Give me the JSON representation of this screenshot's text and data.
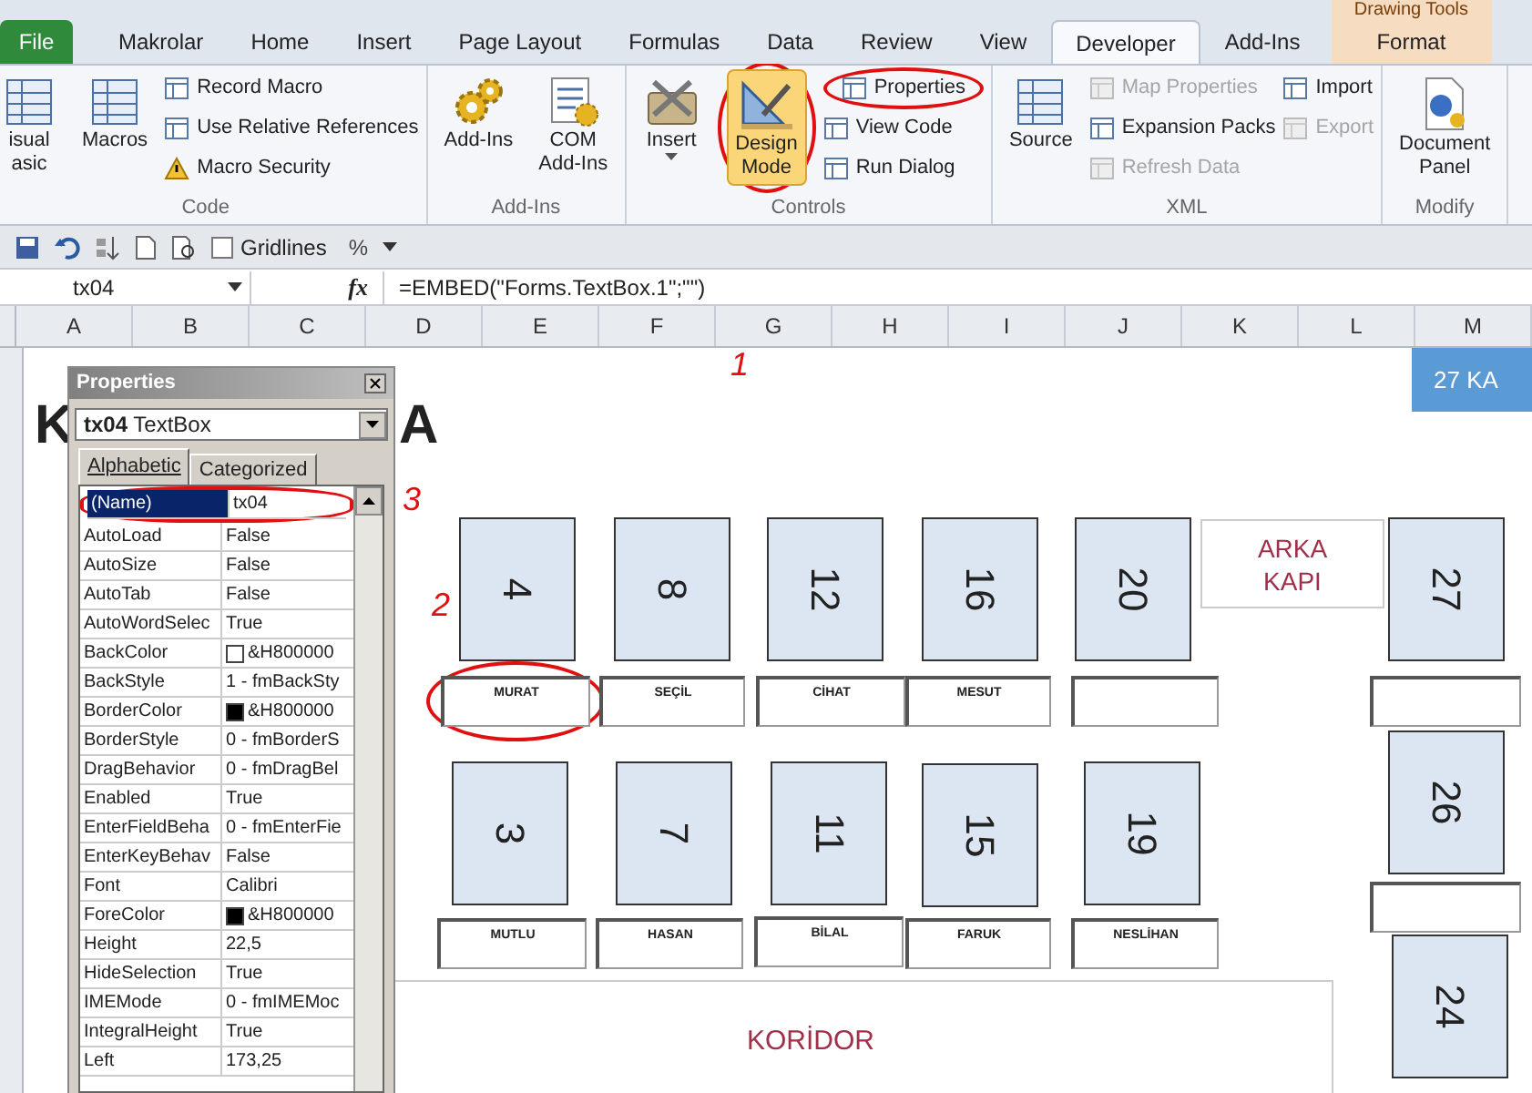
{
  "contextual_tab_group": "Drawing Tools",
  "tabs": [
    {
      "label": "File",
      "kind": "file",
      "selected": false
    },
    {
      "label": "Makrolar",
      "kind": "tab",
      "selected": false
    },
    {
      "label": "Home",
      "kind": "tab",
      "selected": false
    },
    {
      "label": "Insert",
      "kind": "tab",
      "selected": false
    },
    {
      "label": "Page Layout",
      "kind": "tab",
      "selected": false
    },
    {
      "label": "Formulas",
      "kind": "tab",
      "selected": false
    },
    {
      "label": "Data",
      "kind": "tab",
      "selected": false
    },
    {
      "label": "Review",
      "kind": "tab",
      "selected": false
    },
    {
      "label": "View",
      "kind": "tab",
      "selected": false
    },
    {
      "label": "Developer",
      "kind": "tab",
      "selected": true
    },
    {
      "label": "Add-Ins",
      "kind": "tab",
      "selected": false
    },
    {
      "label": "Format",
      "kind": "contextual",
      "selected": false
    }
  ],
  "ribbon_groups": [
    {
      "label": "Code",
      "items": [
        {
          "kind": "large",
          "lines": [
            "isual",
            "asic"
          ],
          "selected": false,
          "disabled": false
        },
        {
          "kind": "large",
          "lines": [
            "Macros"
          ],
          "selected": false,
          "disabled": false
        },
        {
          "kind": "stack",
          "entries": [
            {
              "label": "Record Macro",
              "disabled": false
            },
            {
              "label": "Use Relative References",
              "disabled": false
            },
            {
              "label": "Macro Security",
              "disabled": false
            }
          ]
        }
      ]
    },
    {
      "label": "Add-Ins",
      "items": [
        {
          "kind": "large",
          "lines": [
            "Add-Ins"
          ],
          "selected": false,
          "disabled": false
        },
        {
          "kind": "large",
          "lines": [
            "COM",
            "Add-Ins"
          ],
          "selected": false,
          "disabled": false
        }
      ]
    },
    {
      "label": "Controls",
      "items": [
        {
          "kind": "dropdown",
          "lines": [
            "Insert"
          ],
          "selected": false,
          "disabled": false
        },
        {
          "kind": "large",
          "lines": [
            "Design",
            "Mode"
          ],
          "selected": true,
          "disabled": false
        },
        {
          "kind": "stack",
          "entries": [
            {
              "label": "Properties",
              "disabled": false
            },
            {
              "label": "View Code",
              "disabled": false
            },
            {
              "label": "Run Dialog",
              "disabled": false
            }
          ]
        }
      ]
    },
    {
      "label": "XML",
      "items": [
        {
          "kind": "large",
          "lines": [
            "Source"
          ],
          "selected": false,
          "disabled": false
        },
        {
          "kind": "stack",
          "entries": [
            {
              "label": "Map Properties",
              "disabled": true
            },
            {
              "label": "Expansion Packs",
              "disabled": false
            },
            {
              "label": "Refresh Data",
              "disabled": true
            }
          ]
        },
        {
          "kind": "stack",
          "entries": [
            {
              "label": "Import",
              "disabled": false
            },
            {
              "label": "Export",
              "disabled": true
            }
          ]
        }
      ]
    },
    {
      "label": "Modify",
      "items": [
        {
          "kind": "large",
          "lines": [
            "Document",
            "Panel"
          ],
          "selected": false,
          "disabled": false
        }
      ]
    }
  ],
  "quick_access": {
    "gridlines": {
      "label": "Gridlines",
      "checked": false
    },
    "percent": "%"
  },
  "formula_bar": {
    "name_box": "tx04",
    "fx": "fx",
    "formula": "=EMBED(\"Forms.TextBox.1\";\"\")"
  },
  "columns": [
    "A",
    "B",
    "C",
    "D",
    "E",
    "F",
    "G",
    "H",
    "I",
    "J",
    "K",
    "L",
    "M"
  ],
  "sheet": {
    "title_left": "K",
    "title_right": "A",
    "corner_button": "27 KA",
    "back_door": [
      "ARKA",
      "KAPI"
    ],
    "corridor": "KORİDOR",
    "seats": [
      {
        "number": "4",
        "name": "MURAT"
      },
      {
        "number": "8",
        "name": "SEÇİL"
      },
      {
        "number": "12",
        "name": "CİHAT"
      },
      {
        "number": "16",
        "name": "MESUT"
      },
      {
        "number": "20"
      },
      {
        "number": "27"
      },
      {
        "number": "3",
        "name": "MUTLU"
      },
      {
        "number": "7",
        "name": "HASAN"
      },
      {
        "number": "11",
        "name": "BİLAL"
      },
      {
        "number": "15",
        "name": "FARUK"
      },
      {
        "number": "19",
        "name": "NESLİHAN"
      },
      {
        "number": "26"
      },
      {
        "number": "24"
      }
    ]
  },
  "properties_window": {
    "title": "Properties",
    "object_name": "tx04",
    "object_type": "TextBox",
    "tabs": [
      {
        "label": "Alphabetic",
        "selected": true
      },
      {
        "label": "Categorized",
        "selected": false
      }
    ],
    "rows": [
      {
        "name": "(Name)",
        "value": "tx04",
        "selected": true
      },
      {
        "name": "AutoLoad",
        "value": "False",
        "selected": false
      },
      {
        "name": "AutoSize",
        "value": "False",
        "selected": false
      },
      {
        "name": "AutoTab",
        "value": "False",
        "selected": false
      },
      {
        "name": "AutoWordSelec",
        "value": "True",
        "selected": false
      },
      {
        "name": "BackColor",
        "value": "&H800000",
        "color": "#ffffff",
        "selected": false
      },
      {
        "name": "BackStyle",
        "value": "1 - fmBackSty",
        "selected": false
      },
      {
        "name": "BorderColor",
        "value": "&H800000",
        "color": "#000000",
        "selected": false
      },
      {
        "name": "BorderStyle",
        "value": "0 - fmBorderS",
        "selected": false
      },
      {
        "name": "DragBehavior",
        "value": "0 - fmDragBel",
        "selected": false
      },
      {
        "name": "Enabled",
        "value": "True",
        "selected": false
      },
      {
        "name": "EnterFieldBeha",
        "value": "0 - fmEnterFie",
        "selected": false
      },
      {
        "name": "EnterKeyBehav",
        "value": "False",
        "selected": false
      },
      {
        "name": "Font",
        "value": "Calibri",
        "selected": false
      },
      {
        "name": "ForeColor",
        "value": "&H800000",
        "color": "#000000",
        "selected": false
      },
      {
        "name": "Height",
        "value": "22,5",
        "selected": false
      },
      {
        "name": "HideSelection",
        "value": "True",
        "selected": false
      },
      {
        "name": "IMEMode",
        "value": "0 - fmIMEMoc",
        "selected": false
      },
      {
        "name": "IntegralHeight",
        "value": "True",
        "selected": false
      },
      {
        "name": "Left",
        "value": "173,25",
        "selected": false
      }
    ]
  },
  "annotations": [
    {
      "label": "1"
    },
    {
      "label": "2"
    },
    {
      "label": "3"
    }
  ]
}
